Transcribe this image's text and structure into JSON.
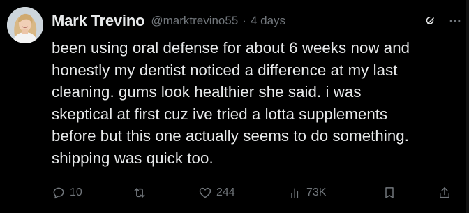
{
  "tweet": {
    "author_name": "Mark Trevino",
    "author_handle": "@marktrevino55",
    "separator": "·",
    "time_ago": "4 days",
    "lines": [
      "been using oral defense for about 6 weeks now and",
      "honestly my dentist noticed a difference at my last",
      "cleaning. gums look healthier she said. i was",
      "skeptical at first cuz ive tried a lotta supplements",
      "before but this one actually seems to do something.",
      "shipping was quick too."
    ],
    "stats": {
      "replies": "10",
      "likes": "244",
      "views": "73K"
    }
  },
  "icons": {
    "reply": "reply-icon",
    "retweet": "retweet-icon",
    "like": "heart-icon",
    "views": "views-icon",
    "bookmark": "bookmark-icon",
    "share": "share-icon",
    "grok": "grok-icon",
    "more": "more-icon"
  },
  "colors": {
    "background": "#000000",
    "text": "#e7e9ea",
    "secondary": "#71767b"
  }
}
